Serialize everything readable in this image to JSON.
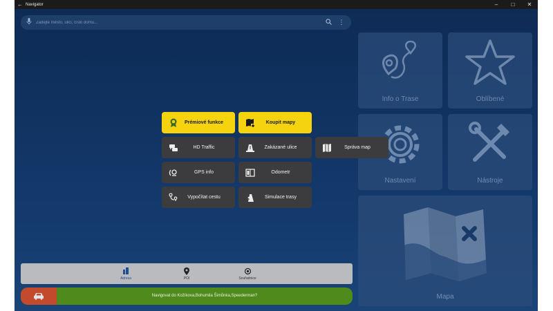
{
  "window": {
    "title": "Navigator",
    "back_icon": "←",
    "minimize": "–",
    "maximize": "□",
    "close": "✕"
  },
  "search": {
    "placeholder": "Zadejte město, ulici, číslo domu..."
  },
  "tiles": [
    {
      "label": "Info o Trase",
      "icon": "route-icon"
    },
    {
      "label": "Oblíbené",
      "icon": "star-icon"
    },
    {
      "label": "Nastavení",
      "icon": "gear-icon"
    },
    {
      "label": "Nástroje",
      "icon": "tools-icon"
    },
    {
      "label": "Mapa",
      "icon": "map-icon"
    }
  ],
  "menu": [
    {
      "label": "Prémiové funkce",
      "icon": "award-icon",
      "style": "yellow"
    },
    {
      "label": "Koupit mapy",
      "icon": "buy-map-icon",
      "style": "yellow"
    },
    {
      "label": "HD Traffic",
      "icon": "traffic-icon",
      "style": "dark"
    },
    {
      "label": "Zakázané ulice",
      "icon": "road-block-icon",
      "style": "dark"
    },
    {
      "label": "Správa map",
      "icon": "map-manage-icon",
      "style": "dark"
    },
    {
      "label": "GPS info",
      "icon": "satellite-icon",
      "style": "dark"
    },
    {
      "label": "Odometr",
      "icon": "odometer-icon",
      "style": "dark"
    },
    {
      "label": "Vypočítat cestu",
      "icon": "compute-route-icon",
      "style": "dark"
    },
    {
      "label": "Simulace trasy",
      "icon": "simulate-route-icon",
      "style": "dark"
    }
  ],
  "bottom_nav": [
    {
      "label": "Adresa",
      "icon": "building-icon",
      "active": true
    },
    {
      "label": "POI",
      "icon": "pin-icon",
      "active": false
    },
    {
      "label": "Souřadnice",
      "icon": "crosshair-icon",
      "active": false
    }
  ],
  "nav_bar": {
    "text": "Navigovat do Kožíkova,Bohumila Šimůnka,Speederman?",
    "icon": "car-icon"
  },
  "colors": {
    "background": "#0f2d57",
    "accent_yellow": "#f5d40f",
    "nav_green": "#4f8a1c",
    "car_red": "#c44a2d"
  }
}
